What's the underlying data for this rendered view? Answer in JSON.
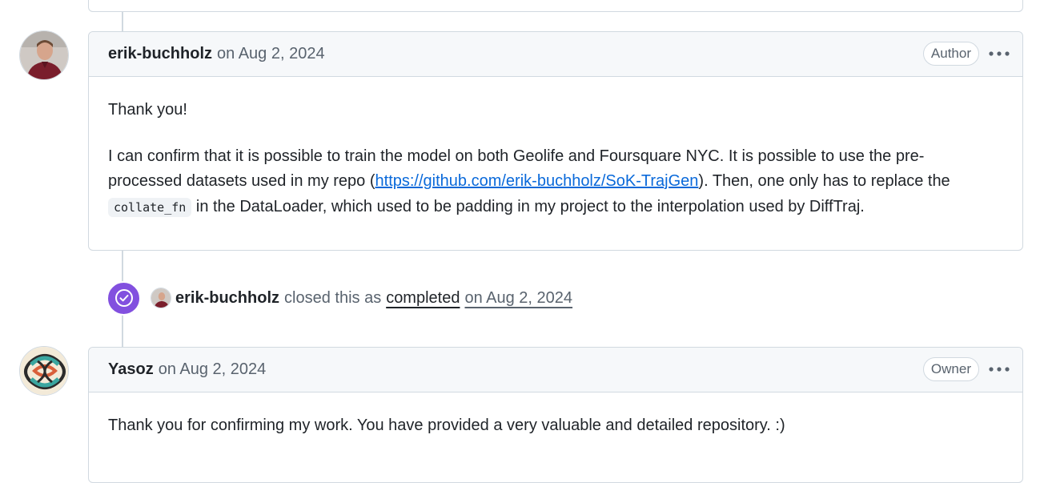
{
  "comments": [
    {
      "author": "erik-buchholz",
      "date": "on Aug 2, 2024",
      "role": "Author",
      "paragraph1": "Thank you!",
      "p2_line1": "I can confirm that it is possible to train the model on both Geolife and Foursquare NYC. It is possible to use the pre-",
      "p2_line2_before": "processed datasets used in my repo (",
      "link_text": "https://github.com/erik-buchholz/SoK-TrajGen",
      "p2_line2_after": "). Then, one only has to replace the",
      "code": "collate_fn",
      "p2_line3_after": " in the DataLoader, which used to be padding in my project to the interpolation used by DiffTraj."
    },
    {
      "author": "Yasoz",
      "date": "on Aug 2, 2024",
      "role": "Owner",
      "paragraph1": "Thank you for confirming my work. You have provided a very valuable and detailed repository. :)"
    }
  ],
  "event": {
    "actor": "erik-buchholz",
    "text": "closed this as",
    "state": "completed",
    "date": "on Aug 2, 2024",
    "icon": "check-circle-icon",
    "color": "#8250df"
  },
  "colors": {
    "border": "#d1d9e0",
    "header_bg": "#f6f8fa",
    "link": "#0969da",
    "muted": "#59636e"
  }
}
